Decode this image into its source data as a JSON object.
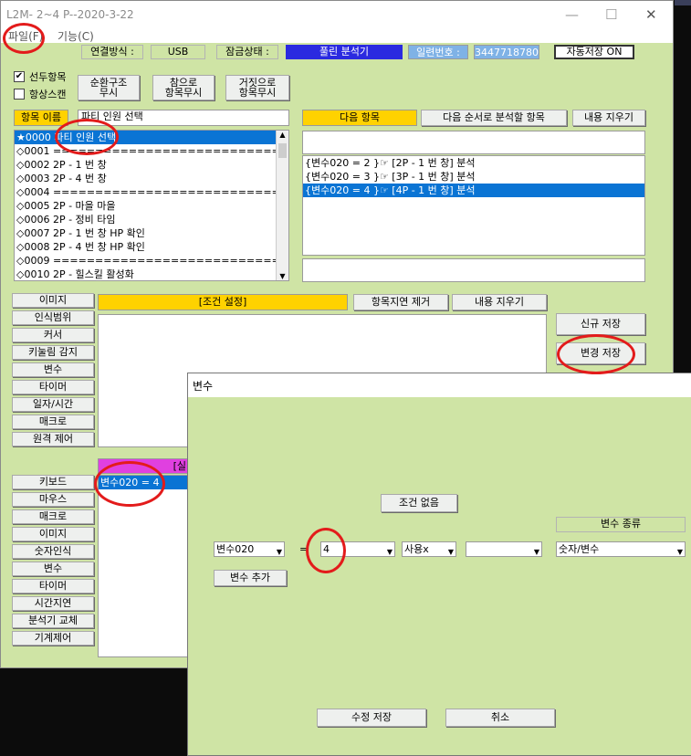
{
  "window": {
    "title": "L2M- 2~4 P--2020-3-22",
    "min_label": "—",
    "max_label": "☐",
    "close_label": "✕"
  },
  "menu": {
    "file": "파일(F)",
    "function": "기능(C)"
  },
  "status": {
    "conn_label": "연결방식 :",
    "conn_value": "USB",
    "lock_label": "잠금상태 :",
    "lock_value": "풀린 분석기",
    "serial_label": "일련번호 :",
    "serial_value": "3447718780",
    "autosave": "자동저장 ON"
  },
  "options": {
    "first_item": "선두항목",
    "always_scan": "항상스캔",
    "first_checked": "✔"
  },
  "buttons": {
    "circular": "순환구조\n무시",
    "true_skip": "참으로\n항목무시",
    "false_skip": "거짓으로\n항목무시",
    "next_order": "다음 순서로 분석할 항목",
    "clear1": "내용 지우기",
    "delay_remove": "항목지연 제거",
    "clear2": "내용 지우기",
    "new_save": "신규 저장",
    "change_save": "변경 저장"
  },
  "item": {
    "name_label": "항목 이름",
    "name_value": "파티 인원 선택"
  },
  "next": {
    "label": "다음 항목"
  },
  "items": [
    {
      "t": "★0000 파티 인원 선택"
    },
    {
      "t": "◇0001 ====================================="
    },
    {
      "t": "◇0002 2P - 1 번 창"
    },
    {
      "t": "◇0003 2P - 4 번 창"
    },
    {
      "t": "◇0004 ====================================="
    },
    {
      "t": "◇0005 2P - 마을 마을"
    },
    {
      "t": "◇0006 2P - 정비 타임"
    },
    {
      "t": "◇0007 2P - 1 번 창 HP 확인"
    },
    {
      "t": "◇0008 2P - 4 번 창 HP 확인"
    },
    {
      "t": "◇0009 ====================================="
    },
    {
      "t": "◇0010 2P - 힐스킬 활성화"
    }
  ],
  "next_items": [
    {
      "t": "{변수020 = 2 }☞ [2P - 1 번 창] 분석"
    },
    {
      "t": "{변수020 = 3 }☞ [3P - 1 번 창] 분석"
    },
    {
      "t": "{변수020 = 4 }☞ [4P - 1 번 창] 분석"
    }
  ],
  "cond": {
    "label": "[조건 설정]"
  },
  "left_buttons": [
    {
      "t": "이미지"
    },
    {
      "t": "인식범위"
    },
    {
      "t": "커서"
    },
    {
      "t": "키눌림 감지"
    },
    {
      "t": "변수"
    },
    {
      "t": "타이머"
    },
    {
      "t": "일자/시간"
    },
    {
      "t": "매크로"
    },
    {
      "t": "원격 제어"
    }
  ],
  "exec": {
    "label": "[실",
    "item": "변수020 = 4"
  },
  "left_buttons2": [
    {
      "t": "키보드"
    },
    {
      "t": "마우스"
    },
    {
      "t": "매크로"
    },
    {
      "t": "이미지"
    },
    {
      "t": "숫자인식"
    },
    {
      "t": "변수"
    },
    {
      "t": "타이머"
    },
    {
      "t": "시간지연"
    },
    {
      "t": "분석기 교체"
    },
    {
      "t": "기계제어"
    }
  ],
  "dialog": {
    "title": "변수",
    "no_cond": "조건 없음",
    "var_type_label": "변수 종류",
    "var_select": "변수020",
    "eq": "=",
    "value": "4",
    "use": "사용x",
    "empty": "",
    "type_value": "숫자/변수",
    "add_var": "변수 추가",
    "save_edit": "수정 저장",
    "cancel": "취소"
  },
  "colors": {
    "bg": "#cfe4a5",
    "accent": "#ffd200",
    "selection": "#0a74d4",
    "magenta": "#e040e0",
    "blue_status": "#2a2ae0",
    "annotation": "#e31b1b"
  }
}
